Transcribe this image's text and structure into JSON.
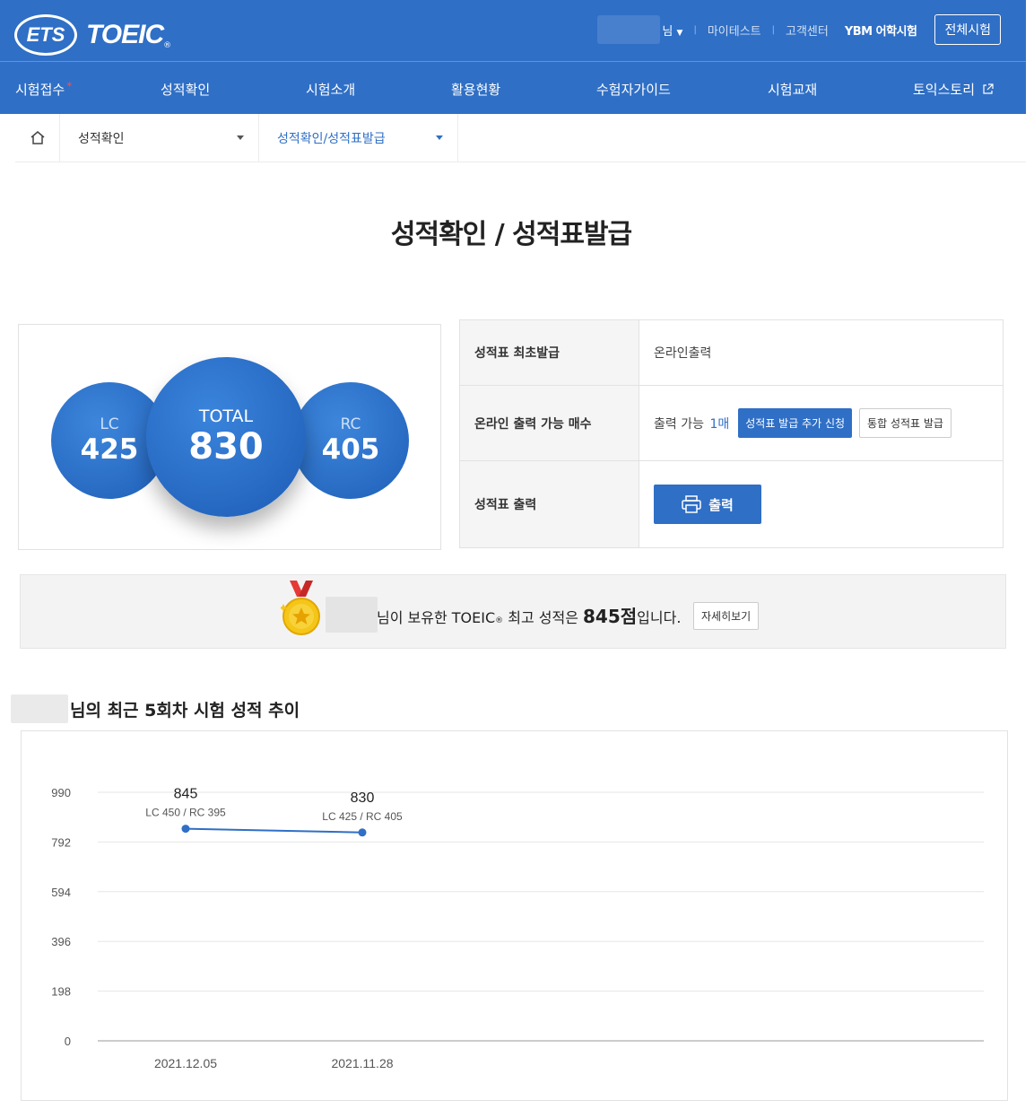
{
  "header": {
    "logo_ets": "ETS",
    "logo_toeic": "TOEIC",
    "logo_reg": "®",
    "user_suffix": "님",
    "util_links": [
      "마이테스트",
      "고객센터"
    ],
    "ybm_label": "YBM 어학시험",
    "all_tests_button": "전체시험",
    "gnb": [
      {
        "label": "시험접수",
        "marker": "*"
      },
      {
        "label": "성적확인"
      },
      {
        "label": "시험소개"
      },
      {
        "label": "활용현황"
      },
      {
        "label": "수험자가이드"
      },
      {
        "label": "시험교재"
      },
      {
        "label": "토익스토리"
      }
    ]
  },
  "breadcrumb": {
    "level1": "성적확인",
    "level2": "성적확인/성적표발급"
  },
  "page_title": "성적확인 / 성적표발급",
  "scores": {
    "lc_label": "LC",
    "lc_value": "425",
    "total_label": "TOTAL",
    "total_value": "830",
    "rc_label": "RC",
    "rc_value": "405"
  },
  "info_table": {
    "row1_head": "성적표 최초발급",
    "row1_value": "온라인출력",
    "row2_head": "온라인 출력 가능 매수",
    "row2_prefix": "출력 가능",
    "row2_count": "1매",
    "row2_btn_add": "성적표 발급 추가 신청",
    "row2_btn_integrated": "통합 성적표 발급",
    "row3_head": "성적표 출력",
    "row3_btn_print": "출력"
  },
  "best_banner": {
    "text_a": "님이 보유한 TOEIC",
    "reg": "®",
    "text_b": " 최고 성적은 ",
    "score": "845점",
    "text_c": "입니다.",
    "detail_button": "자세히보기"
  },
  "trend": {
    "title_suffix": "님의 최근 5회차 시험 성적 추이"
  },
  "chart_data": {
    "type": "line",
    "title": "",
    "xlabel": "",
    "ylabel": "",
    "ylim": [
      0,
      990
    ],
    "yticks": [
      0,
      198,
      396,
      594,
      792,
      990
    ],
    "grid": true,
    "categories": [
      "2021.12.05",
      "2021.11.28"
    ],
    "series": [
      {
        "values": [
          845,
          830
        ],
        "sublabels": [
          "LC 450 / RC 395",
          "LC 425 / RC 405"
        ]
      }
    ],
    "color": "#2f6fc6"
  },
  "colors": {
    "brand_blue": "#2f6fc6",
    "medal_gold": "#f5c518",
    "medal_ribbon": "#e53935"
  }
}
